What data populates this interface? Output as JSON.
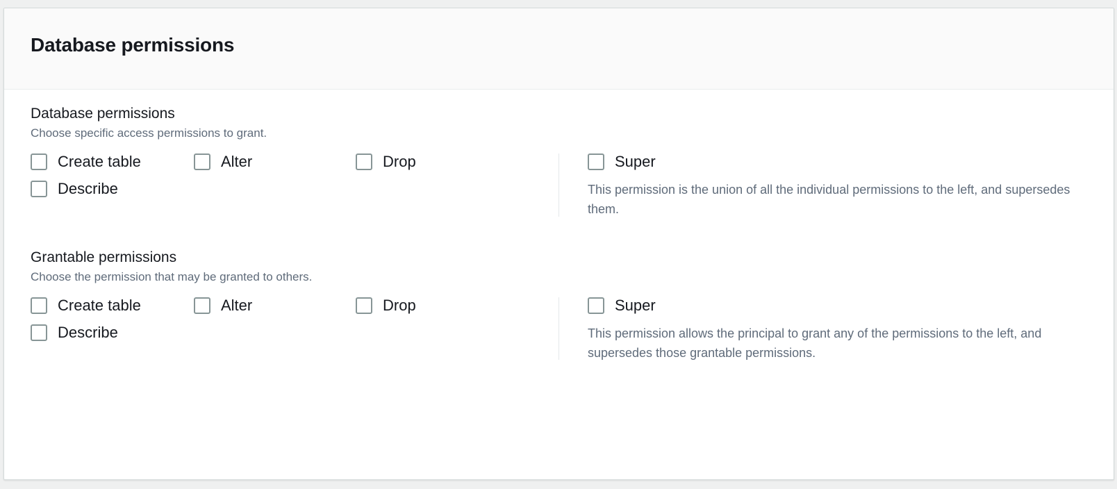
{
  "card": {
    "header_title": "Database permissions"
  },
  "sections": [
    {
      "id": "database-permissions",
      "label": "Database permissions",
      "description": "Choose specific access permissions to grant.",
      "permissions": [
        {
          "label": "Create table",
          "checked": false
        },
        {
          "label": "Alter",
          "checked": false
        },
        {
          "label": "Drop",
          "checked": false
        },
        {
          "label": "Describe",
          "checked": false
        }
      ],
      "super": {
        "label": "Super",
        "checked": false,
        "description": "This permission is the union of all the individual permissions to the left, and supersedes them."
      }
    },
    {
      "id": "grantable-permissions",
      "label": "Grantable permissions",
      "description": "Choose the permission that may be granted to others.",
      "permissions": [
        {
          "label": "Create table",
          "checked": false
        },
        {
          "label": "Alter",
          "checked": false
        },
        {
          "label": "Drop",
          "checked": false
        },
        {
          "label": "Describe",
          "checked": false
        }
      ],
      "super": {
        "label": "Super",
        "checked": false,
        "description": "This permission allows the principal to grant any of the permissions to the left, and supersedes those grantable permissions."
      }
    }
  ],
  "colors": {
    "page_background": "#eff0f0",
    "card_background": "#ffffff",
    "header_background": "#fafafa",
    "border": "#d5dbdb",
    "divider": "#e4e8ea",
    "text_primary": "#16191f",
    "text_secondary": "#5f6b7a",
    "checkbox_border": "#879596"
  }
}
